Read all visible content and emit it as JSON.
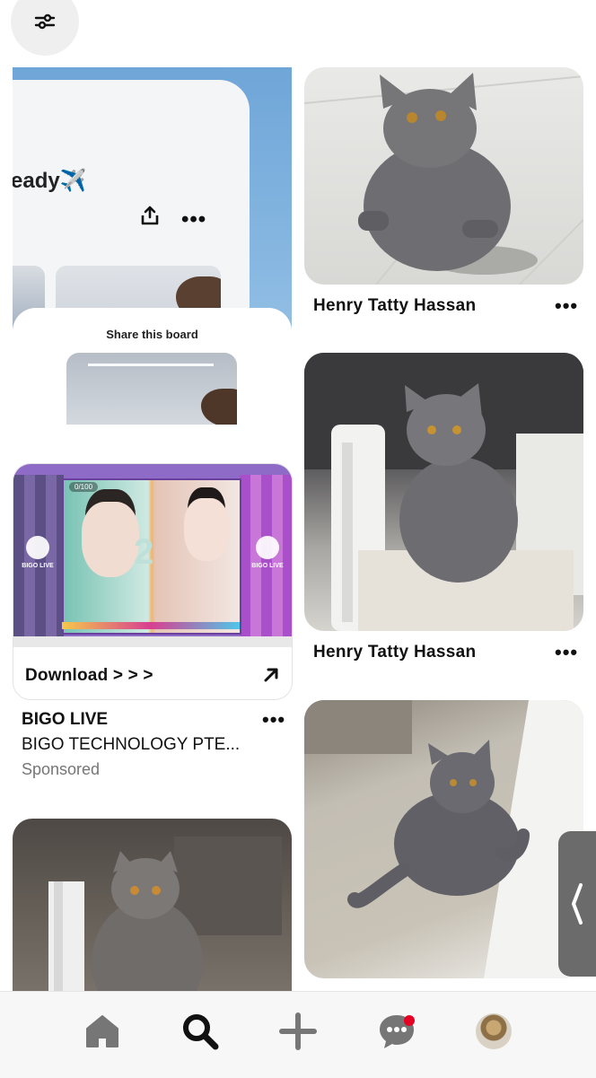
{
  "toolbar": {
    "filter_icon": "sliders-icon"
  },
  "board_card": {
    "title_fragment": "eady",
    "title_emoji": "✈️",
    "share_sheet_title": "Share this board",
    "icons": [
      "share-icon",
      "more-icon"
    ]
  },
  "ad": {
    "brand_watermark": "BIGO LIVE",
    "live_counter": "0/100",
    "overlay_number": "2",
    "cta_label": "Download > > >",
    "title": "BIGO LIVE",
    "advertiser": "BIGO TECHNOLOGY PTE...",
    "sponsored_label": "Sponsored",
    "more_icon": "more-icon"
  },
  "pins": [
    {
      "id": "cat-1",
      "title": "Henry Tatty Hassan",
      "more_icon": "more-icon"
    },
    {
      "id": "cat-2",
      "title": "Henry Tatty Hassan",
      "more_icon": "more-icon"
    },
    {
      "id": "cat-3",
      "title": ""
    },
    {
      "id": "cat-4",
      "title": ""
    }
  ],
  "nav": {
    "items": [
      {
        "name": "home",
        "icon": "home-icon"
      },
      {
        "name": "search",
        "icon": "search-icon",
        "active": true
      },
      {
        "name": "create",
        "icon": "plus-icon"
      },
      {
        "name": "messages",
        "icon": "chat-icon",
        "badge": true
      },
      {
        "name": "profile",
        "icon": "avatar"
      }
    ]
  },
  "colors": {
    "notification": "#e60023",
    "active_icon": "#111111",
    "inactive_icon": "#767676"
  }
}
